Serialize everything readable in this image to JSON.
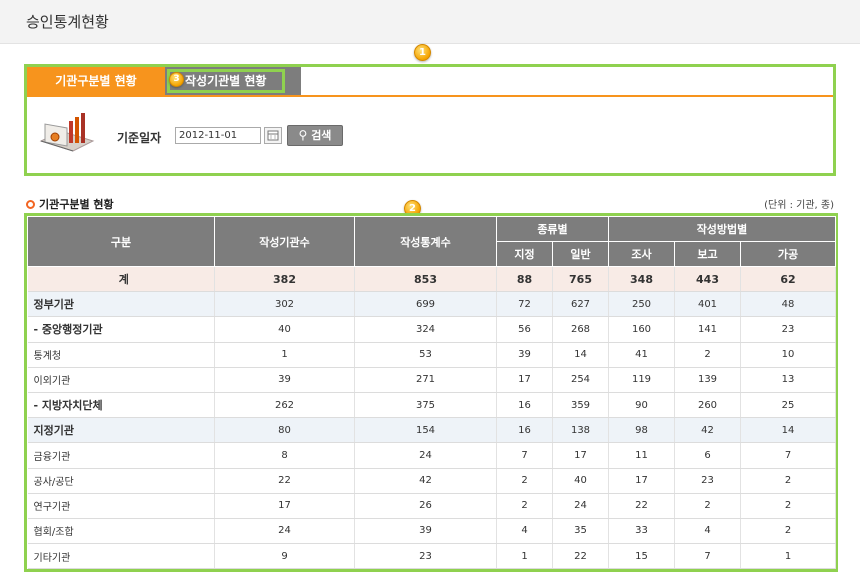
{
  "page": {
    "title": "승인통계현황"
  },
  "markers": {
    "m1": "1",
    "m2": "2",
    "m3": "3"
  },
  "tabs": [
    {
      "label": "기관구분별 현황"
    },
    {
      "label": "작성기관별 현황"
    }
  ],
  "search": {
    "date_label": "기준일자",
    "date_value": "2012-11-01",
    "search_label": "검색"
  },
  "section": {
    "title": "기관구분별 현황",
    "unit": "(단위 : 기관, 종)"
  },
  "table": {
    "headers": {
      "category": "구분",
      "org_count": "작성기관수",
      "stat_count": "작성통계수",
      "type_group": "종류별",
      "designated": "지정",
      "general": "일반",
      "method_group": "작성방법별",
      "survey": "조사",
      "report": "보고",
      "processing": "가공"
    },
    "rows": [
      {
        "name": "계",
        "org": "382",
        "stat": "853",
        "des": "88",
        "gen": "765",
        "sur": "348",
        "rep": "443",
        "pro": "62"
      },
      {
        "name": "정부기관",
        "org": "302",
        "stat": "699",
        "des": "72",
        "gen": "627",
        "sur": "250",
        "rep": "401",
        "pro": "48"
      },
      {
        "name": "- 중앙행정기관",
        "org": "40",
        "stat": "324",
        "des": "56",
        "gen": "268",
        "sur": "160",
        "rep": "141",
        "pro": "23"
      },
      {
        "name": "통계청",
        "org": "1",
        "stat": "53",
        "des": "39",
        "gen": "14",
        "sur": "41",
        "rep": "2",
        "pro": "10"
      },
      {
        "name": "이외기관",
        "org": "39",
        "stat": "271",
        "des": "17",
        "gen": "254",
        "sur": "119",
        "rep": "139",
        "pro": "13"
      },
      {
        "name": "- 지방자치단체",
        "org": "262",
        "stat": "375",
        "des": "16",
        "gen": "359",
        "sur": "90",
        "rep": "260",
        "pro": "25"
      },
      {
        "name": "지정기관",
        "org": "80",
        "stat": "154",
        "des": "16",
        "gen": "138",
        "sur": "98",
        "rep": "42",
        "pro": "14"
      },
      {
        "name": "금융기관",
        "org": "8",
        "stat": "24",
        "des": "7",
        "gen": "17",
        "sur": "11",
        "rep": "6",
        "pro": "7"
      },
      {
        "name": "공사/공단",
        "org": "22",
        "stat": "42",
        "des": "2",
        "gen": "40",
        "sur": "17",
        "rep": "23",
        "pro": "2"
      },
      {
        "name": "연구기관",
        "org": "17",
        "stat": "26",
        "des": "2",
        "gen": "24",
        "sur": "22",
        "rep": "2",
        "pro": "2"
      },
      {
        "name": "협회/조합",
        "org": "24",
        "stat": "39",
        "des": "4",
        "gen": "35",
        "sur": "33",
        "rep": "4",
        "pro": "2"
      },
      {
        "name": "기타기관",
        "org": "9",
        "stat": "23",
        "des": "1",
        "gen": "22",
        "sur": "15",
        "rep": "7",
        "pro": "1"
      }
    ]
  }
}
